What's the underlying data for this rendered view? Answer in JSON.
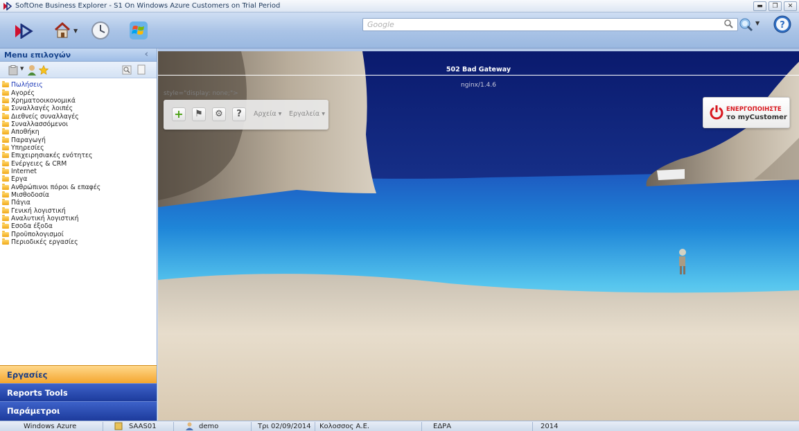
{
  "window": {
    "title": "SoftOne Business Explorer - S1 On Windows Azure Customers on Trial Period"
  },
  "toolbar": {
    "icons": [
      "softone-logo-icon",
      "home-icon",
      "clock-icon",
      "windows-icon",
      "search-icon",
      "web-search-icon",
      "help-icon"
    ],
    "search_placeholder": "Google"
  },
  "sidebar": {
    "header": "Menu επιλογών",
    "items": [
      {
        "label": "Πωλήσεις"
      },
      {
        "label": "Αγορές"
      },
      {
        "label": "Χρηματοοικονομικά"
      },
      {
        "label": "Συναλλαγές λοιπές"
      },
      {
        "label": "Διεθνείς συναλλαγές"
      },
      {
        "label": "Συναλλασσόμενοι"
      },
      {
        "label": "Αποθήκη"
      },
      {
        "label": "Παραγωγή"
      },
      {
        "label": "Υπηρεσίες"
      },
      {
        "label": "Επιχειρησιακές ενότητες"
      },
      {
        "label": "Ενέργειες & CRM"
      },
      {
        "label": "Internet"
      },
      {
        "label": "Εργα"
      },
      {
        "label": "Ανθρώπινοι πόροι & επαφές"
      },
      {
        "label": "Μισθοδοσία"
      },
      {
        "label": "Πάγια"
      },
      {
        "label": "Γενική λογιστική"
      },
      {
        "label": "Αναλυτική λογιστική"
      },
      {
        "label": "Εσοδα έξοδα"
      },
      {
        "label": "Προϋπολογισμοί"
      },
      {
        "label": "Περιοδικές εργασίες"
      }
    ],
    "bottom": {
      "jobs": "Εργασίες",
      "reports": "Reports Tools",
      "params": "Παράμετροι"
    }
  },
  "main": {
    "error_title": "502 Bad Gateway",
    "error_sub": "nginx/1.4.6",
    "style_leak": "style=\"display: none;\">",
    "float_toolbar": {
      "menu_files": "Αρχεία",
      "menu_tools": "Εργαλεία"
    },
    "activate": {
      "line1": "ΕΝΕΡΓΟΠΟΙΗΣΤΕ",
      "line2": "το myCustomer"
    }
  },
  "statusbar": {
    "cloud": "Windows Azure",
    "server": "SAAS01",
    "user": "demo",
    "date": "Τρι 02/09/2014",
    "company": "Κολοσσος Α.Ε.",
    "branch": "ΕΔΡΑ",
    "year": "2014"
  },
  "colors": {
    "accent_orange": "#f4a62f",
    "nav_blue": "#1d3b9c",
    "toolbar_blue": "#a9c3e6",
    "activate_red": "#d8171e"
  }
}
